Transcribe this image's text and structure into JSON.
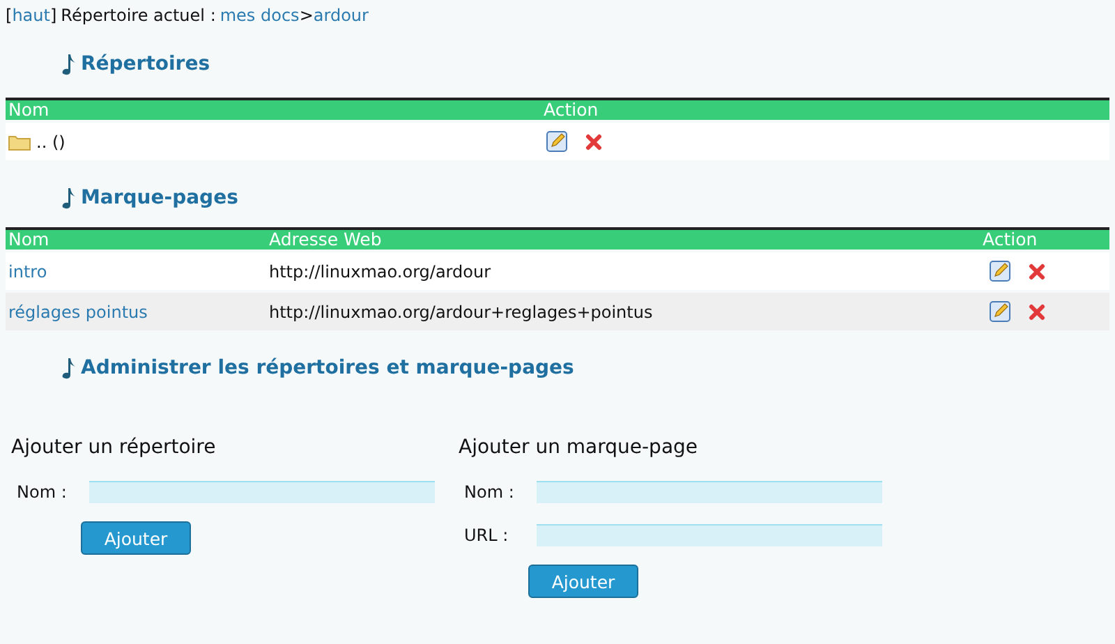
{
  "breadcrumb": {
    "open_bracket": "[",
    "top_link": "haut",
    "close_bracket": "]",
    "label": "Répertoire actuel :",
    "path": [
      {
        "text": "mes docs"
      },
      {
        "text": "ardour"
      }
    ],
    "separator": ">"
  },
  "directories": {
    "heading": "Répertoires",
    "columns": [
      "Nom",
      "Action"
    ],
    "rows": [
      {
        "name": ".. ()"
      }
    ]
  },
  "bookmarks": {
    "heading": "Marque-pages",
    "columns": [
      "Nom",
      "Adresse Web",
      "Action"
    ],
    "rows": [
      {
        "name": "intro",
        "url": "http://linuxmao.org/ardour"
      },
      {
        "name": "réglages pointus",
        "url": "http://linuxmao.org/ardour+reglages+pointus"
      }
    ]
  },
  "admin": {
    "heading": "Administrer les répertoires et marque-pages",
    "forms": [
      {
        "title": "Ajouter un répertoire",
        "fields": [
          {
            "label": "Nom :"
          }
        ],
        "button": "Ajouter"
      },
      {
        "title": "Ajouter un marque-page",
        "fields": [
          {
            "label": "Nom :"
          },
          {
            "label": "URL :"
          }
        ],
        "button": "Ajouter"
      }
    ]
  }
}
